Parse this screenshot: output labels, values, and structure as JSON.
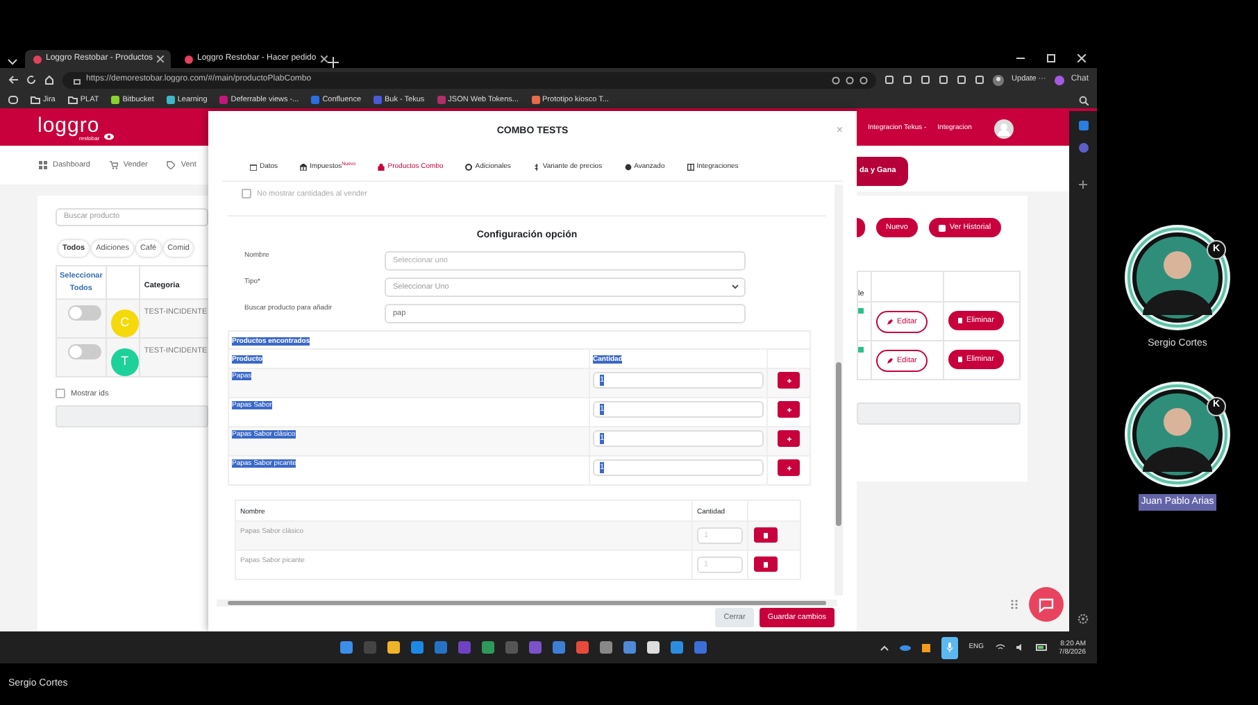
{
  "browser": {
    "tabs": [
      {
        "title": "Loggro Restobar - Productos",
        "selected": true
      },
      {
        "title": "Loggro Restobar - Hacer pedido",
        "selected": false
      }
    ],
    "url": "https://demorestobar.loggro.com/#/main/productoPlabCombo",
    "update_label": "Update ···",
    "chat_label": "Chat",
    "bookmarks": [
      {
        "label": "Jira",
        "kind": "folder"
      },
      {
        "label": "PLAT",
        "kind": "folder"
      },
      {
        "label": "Bitbucket",
        "kind": "site",
        "color": "#8bd12e"
      },
      {
        "label": "Learning",
        "kind": "site",
        "color": "#3fb7c4"
      },
      {
        "label": "Deferrable views -...",
        "kind": "site",
        "color": "#c2187a"
      },
      {
        "label": "Confluence",
        "kind": "site",
        "color": "#2b6fe0"
      },
      {
        "label": "Buk - Tekus",
        "kind": "site",
        "color": "#4a5bd8"
      },
      {
        "label": "JSON Web Tokens...",
        "kind": "site",
        "color": "#b0306a"
      },
      {
        "label": "Prototipo kiosco T...",
        "kind": "site",
        "color": "#e86c4a"
      }
    ]
  },
  "app": {
    "logo": "loggro",
    "logo_sub": "restobar",
    "nav": [
      "Dashboard",
      "Vender",
      "Vent"
    ],
    "search": {
      "placeholder": "Buscar producto"
    },
    "filters": [
      {
        "label": "Todos",
        "selected": true
      },
      {
        "label": "Adiciones",
        "selected": false
      },
      {
        "label": "Café",
        "selected": false
      },
      {
        "label": "Comid",
        "selected": false
      }
    ],
    "table": {
      "columns": [
        "Seleccionar Todos",
        "Categoria"
      ],
      "column_fragment": "le",
      "rows": [
        {
          "on": false,
          "initial": "C",
          "color": "#f5d90a",
          "category": "TEST-INCIDENTE",
          "edit": "Editar",
          "delete": "Eliminar"
        },
        {
          "on": false,
          "initial": "T",
          "color": "#1dd19a",
          "category": "TEST-INCIDENTE",
          "edit": "Editar",
          "delete": "Eliminar"
        }
      ]
    },
    "show_ids": {
      "label": "Mostrar ids",
      "checked": false
    },
    "header_links": [
      "Integracion Tekus -",
      "Integracion"
    ],
    "promo_button": "da y Gana",
    "buttons": [
      "Nuevo",
      "Ver Historial"
    ]
  },
  "modal": {
    "title": "COMBO TESTS",
    "close": "×",
    "tabs": [
      {
        "label": "Datos",
        "selected": false
      },
      {
        "label": "Impuestos",
        "badge": "Nuevo",
        "selected": false
      },
      {
        "label": "Productos Combo",
        "selected": true
      },
      {
        "label": "Adicionales",
        "selected": false
      },
      {
        "label": "Variante de precios",
        "selected": false
      },
      {
        "label": "Avanzado",
        "selected": false
      },
      {
        "label": "Integraciones",
        "selected": false
      }
    ],
    "hide_quantities": {
      "label": "No mostrar cantidades al vender",
      "checked": false
    },
    "section_title": "Configuración opción",
    "fields": [
      {
        "label": "Nombre",
        "kind": "input",
        "placeholder": "Seleccionar uno"
      },
      {
        "label": "Tipo*",
        "kind": "select",
        "value": "Seleccionar Uno"
      },
      {
        "label": "Buscar producto para añadir",
        "kind": "input",
        "value": "pap"
      }
    ],
    "found": {
      "title": "Productos encontrados",
      "columns": [
        "Producto",
        "Cantidad"
      ],
      "text_selected": true,
      "rows": [
        {
          "name": "Papas",
          "quantity": "1"
        },
        {
          "name": "Papas Sabor",
          "quantity": "1"
        },
        {
          "name": "Papas Sabor clásico",
          "quantity": "1"
        },
        {
          "name": "Papas Sabor picante",
          "quantity": "1"
        }
      ]
    },
    "added": {
      "columns": [
        "Nombre",
        "Cantidad"
      ],
      "rows": [
        {
          "name": "Papas Sabor clásico",
          "quantity_placeholder": "1"
        },
        {
          "name": "Papas Sabor picante",
          "quantity_placeholder": "1"
        }
      ]
    },
    "buttons": [
      {
        "label": "Cerrar",
        "kind": "secondary"
      },
      {
        "label": "Guardar cambios",
        "kind": "primary"
      }
    ]
  },
  "taskbar": {
    "language": "ENG",
    "time": "8:20 AM",
    "date": "7/8/2026"
  },
  "call": {
    "participants": [
      {
        "name": "Sergio Cortes",
        "badge": "K",
        "speaking": false
      },
      {
        "name": "Juan Pablo Arias",
        "badge": "K",
        "speaking": true
      }
    ],
    "presenter": "Sergio Cortes"
  }
}
